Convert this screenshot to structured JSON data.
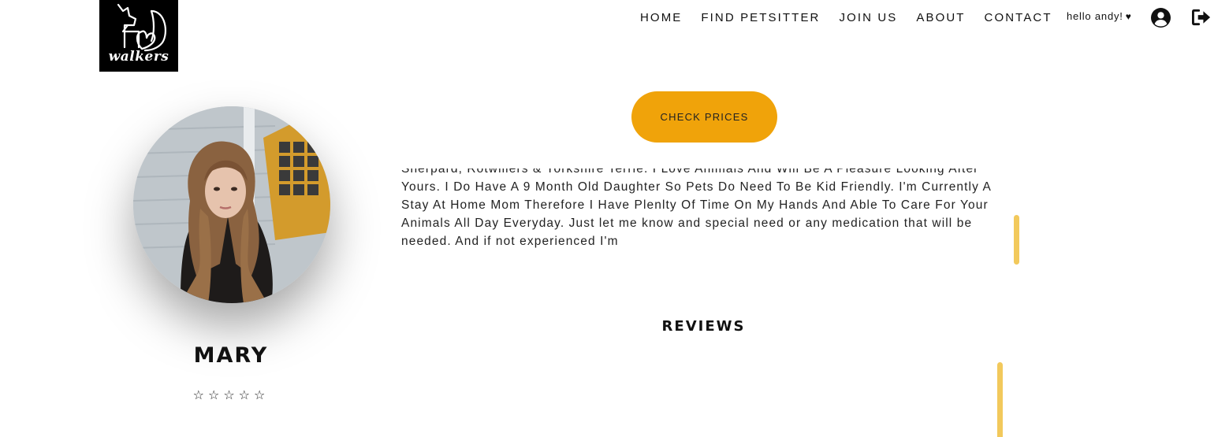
{
  "logo": {
    "text": "walkers"
  },
  "nav": {
    "items": [
      "HOME",
      "FIND PETSITTER",
      "JOIN US",
      "ABOUT",
      "CONTACT"
    ],
    "greeting": "hello andy!",
    "heart": "♥",
    "user_icon": "user-circle-icon",
    "logout_icon": "logout-icon"
  },
  "actions": {
    "check_prices": "CHECK PRICES"
  },
  "sitter": {
    "name": "MARY",
    "rating_display": "☆☆☆☆☆",
    "rating": 0,
    "rating_max": 5,
    "bio": "Sherpard, Rotwillers & Yorkshire Terrie. I Love Animals And Will Be A Pleasure Looking After Yours. I Do Have A 9 Month Old Daughter So Pets Do Need To Be Kid Friendly. I'm Currently A Stay At Home Mom Therefore I Have Plenlty Of Time On My Hands And Able To Care For Your Animals All Day Everyday. Just let me know and special need or any medication that will be needed. And if not experienced I'm"
  },
  "reviews": {
    "title": "REVIEWS"
  },
  "colors": {
    "accent": "#f0a30a",
    "scrollbar": "#f2c95c",
    "logo_bg": "#000000"
  }
}
